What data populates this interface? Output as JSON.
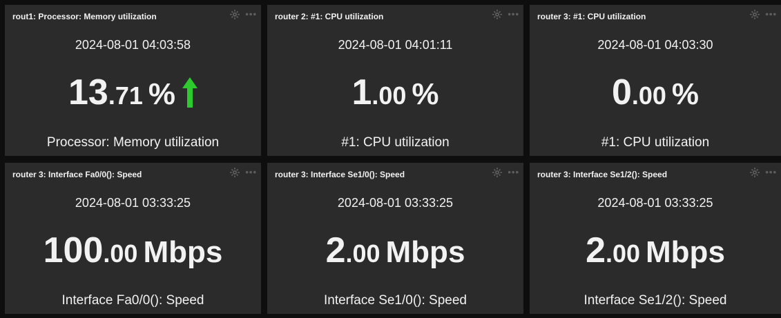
{
  "widgets": [
    {
      "title": "rout1: Processor: Memory utilization",
      "timestamp": "2024-08-01 04:03:58",
      "value_int": "13",
      "value_dec": ".71",
      "unit": "%",
      "description": "Processor: Memory utilization",
      "trend": "up",
      "trend_icon": "arrow-up-icon",
      "trend_color": "#2ec92e"
    },
    {
      "title": "router 2: #1: CPU utilization",
      "timestamp": "2024-08-01 04:01:11",
      "value_int": "1",
      "value_dec": ".00",
      "unit": "%",
      "description": "#1: CPU utilization"
    },
    {
      "title": "router 3: #1: CPU utilization",
      "timestamp": "2024-08-01 04:03:30",
      "value_int": "0",
      "value_dec": ".00",
      "unit": "%",
      "description": "#1: CPU utilization"
    },
    {
      "title": "router 3: Interface Fa0/0(): Speed",
      "timestamp": "2024-08-01 03:33:25",
      "value_int": "100",
      "value_dec": ".00",
      "unit": "Mbps",
      "description": "Interface Fa0/0(): Speed"
    },
    {
      "title": "router 3: Interface Se1/0(): Speed",
      "timestamp": "2024-08-01 03:33:25",
      "value_int": "2",
      "value_dec": ".00",
      "unit": "Mbps",
      "description": "Interface Se1/0(): Speed"
    },
    {
      "title": "router 3: Interface Se1/2(): Speed",
      "timestamp": "2024-08-01 03:33:25",
      "value_int": "2",
      "value_dec": ".00",
      "unit": "Mbps",
      "description": "Interface Se1/2(): Speed"
    }
  ],
  "header_icons": [
    "gear-icon",
    "more-icon"
  ],
  "colors": {
    "widget_bg": "#2b2b2b",
    "dashboard_bg": "#0e0e0e",
    "text": "#f2f2f2",
    "icon_muted": "#5e5e5e",
    "trend_up": "#2ec92e"
  }
}
